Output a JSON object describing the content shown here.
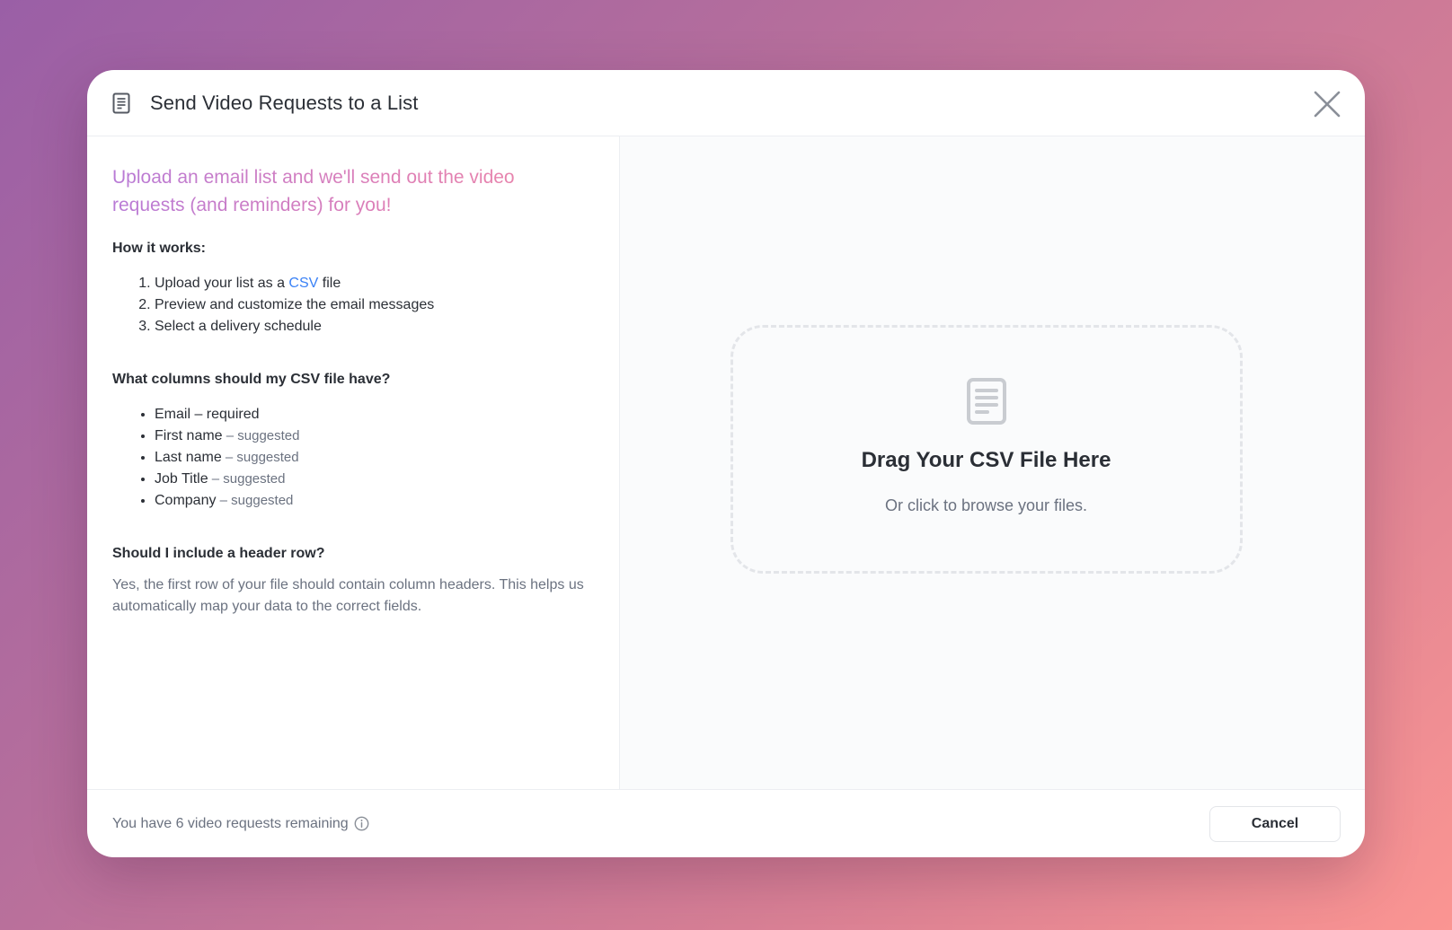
{
  "dialog": {
    "title": "Send Video Requests to a List",
    "header_icon": "document-icon",
    "close_icon": "close-icon"
  },
  "left": {
    "headline": "Upload an email list and we'll send out the video requests (and reminders) for you!",
    "how_it_works": {
      "title": "How it works:",
      "steps": {
        "step1_before": "Upload your list as a ",
        "step1_link": "CSV",
        "step1_after": " file",
        "step2": "Preview and customize the email messages",
        "step3": "Select a delivery schedule"
      }
    },
    "columns": {
      "title": "What columns should my CSV file have?",
      "items": [
        {
          "name": "Email – required",
          "note": ""
        },
        {
          "name": "First name",
          "note": " – suggested"
        },
        {
          "name": "Last name",
          "note": " – suggested"
        },
        {
          "name": "Job Title",
          "note": " – suggested"
        },
        {
          "name": "Company",
          "note": " – suggested"
        }
      ]
    },
    "header_row": {
      "title": "Should I include a header row?",
      "text": "Yes, the first row of your file should contain column headers. This helps us automatically map your data to the correct fields."
    }
  },
  "dropzone": {
    "icon": "document-icon",
    "title": "Drag Your CSV File Here",
    "subtitle": "Or click to browse your files."
  },
  "footer": {
    "remaining_text": "You have 6 video requests remaining",
    "info_icon": "info-icon",
    "cancel_label": "Cancel"
  }
}
